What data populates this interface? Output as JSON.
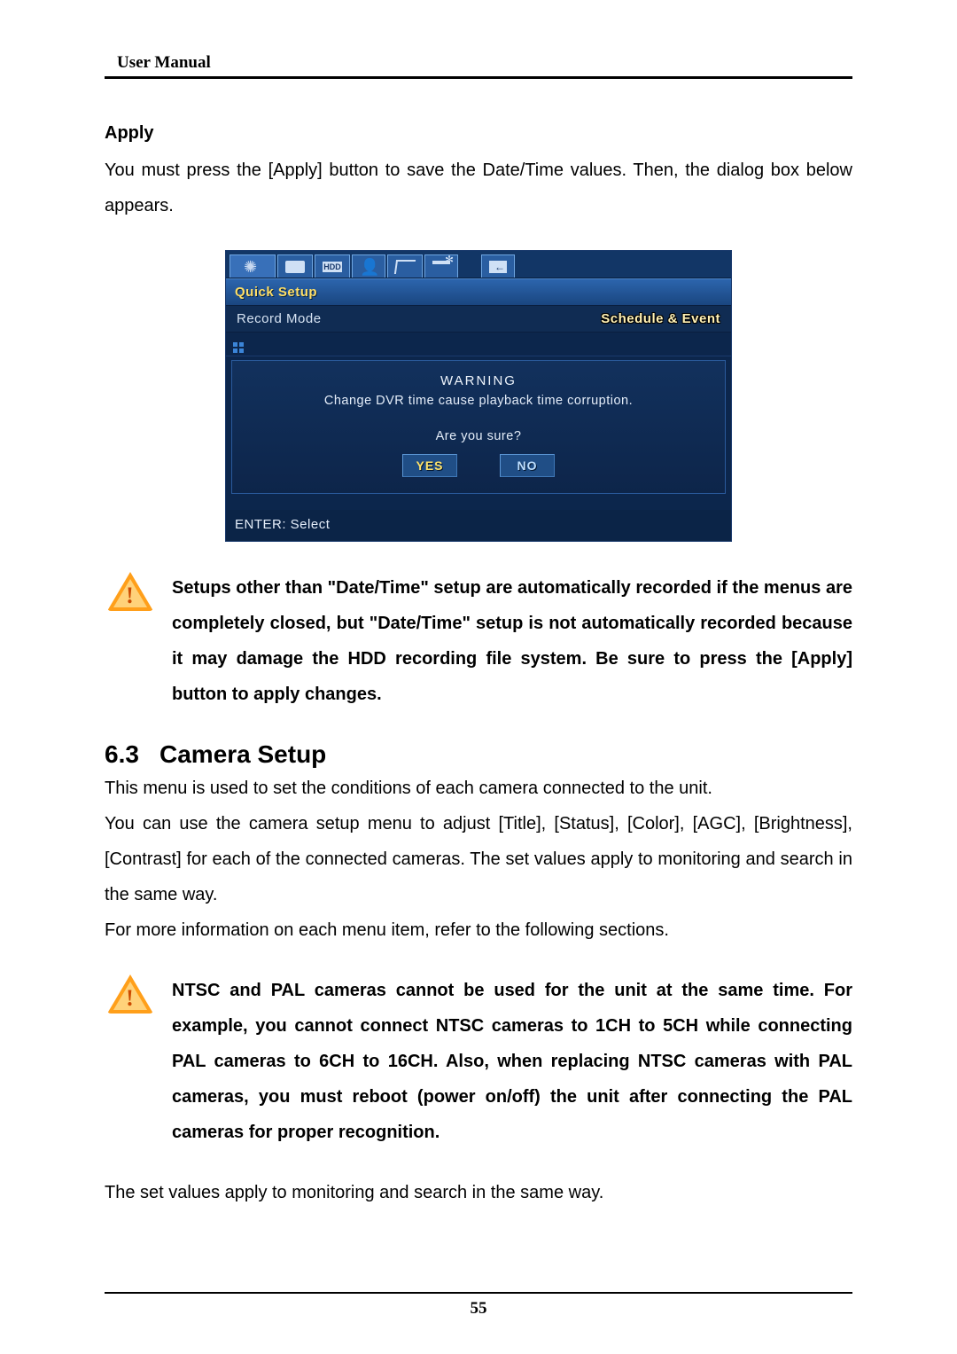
{
  "header": "User Manual",
  "s1": {
    "title": "Apply",
    "p1": "You must press the [Apply] button to save the Date/Time values. Then, the dialog box below appears."
  },
  "dialog": {
    "tabs": {
      "hdd": "HDD"
    },
    "title": "Quick Setup",
    "row_label": "Record Mode",
    "row_badge": "Schedule & Event",
    "warning": "WARNING",
    "msg": "Change DVR time cause playback time corruption.",
    "ask": "Are you sure?",
    "yes": "YES",
    "no": "NO",
    "footer": "ENTER: Select"
  },
  "note1": "Setups other than \"Date/Time\" setup are automatically recorded if the menus are completely closed, but \"Date/Time\" setup is not automatically recorded because it may damage the HDD recording file system. Be sure to press the [Apply] button to apply changes.",
  "s2": {
    "num": "6.3",
    "title": "Camera Setup",
    "p1": "This menu is used to set the conditions of each camera connected to the unit.",
    "p2": "You can use the camera setup menu to adjust [Title], [Status], [Color], [AGC], [Brightness], [Contrast] for each of the connected cameras. The set values apply to monitoring and search in the same way.",
    "p3": "For more information on each menu item, refer to the following sections."
  },
  "note2": "NTSC and PAL cameras cannot be used for the unit at the same time. For example, you cannot connect NTSC cameras to 1CH to 5CH while connecting PAL cameras to 6CH to 16CH. Also, when replacing NTSC cameras with PAL cameras, you must reboot (power on/off) the unit after connecting the PAL cameras for proper recognition.",
  "s2_p4": "The set values apply to monitoring and search in the same way.",
  "page_number": "55"
}
